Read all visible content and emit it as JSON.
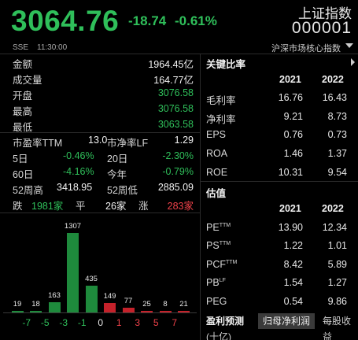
{
  "header": {
    "price": "3064.76",
    "change": "-18.74",
    "change_pct": "-0.61%",
    "index_name": "上证指数",
    "index_code": "000001",
    "exchange": "SSE",
    "time": "11:30:00",
    "subtitle": "沪深市场核心指数"
  },
  "stats": {
    "amount_label": "金额",
    "amount": "1964.45亿",
    "volume_label": "成交量",
    "volume": "164.77亿",
    "open_label": "开盘",
    "open": "3076.58",
    "high_label": "最高",
    "high": "3076.58",
    "low_label": "最低",
    "low": "3063.58",
    "pe_label": "市盈率TTM",
    "pe": "13.0",
    "pb_label": "市净率LF",
    "pb": "1.29",
    "d5_label": "5日",
    "d5": "-0.46%",
    "d20_label": "20日",
    "d20": "-2.30%",
    "d60_label": "60日",
    "d60": "-4.16%",
    "ytd_label": "今年",
    "ytd": "-0.79%",
    "w52h_label": "52周高",
    "w52h": "3418.95",
    "w52l_label": "52周低",
    "w52l": "2885.09",
    "fall_label": "跌",
    "fall": "1981家",
    "flat_label": "平",
    "flat": "26家",
    "rise_label": "涨",
    "rise": "283家"
  },
  "ratios": {
    "title": "关键比率",
    "years": [
      "2021",
      "2022"
    ],
    "rows": [
      {
        "label": "毛利率",
        "v2021": "16.76",
        "v2022": "16.43"
      },
      {
        "label": "净利率",
        "v2021": "9.21",
        "v2022": "8.73"
      },
      {
        "label": "EPS",
        "v2021": "0.76",
        "v2022": "0.73"
      },
      {
        "label": "ROA",
        "v2021": "1.46",
        "v2022": "1.37"
      },
      {
        "label": "ROE",
        "v2021": "10.31",
        "v2022": "9.54"
      }
    ]
  },
  "valuation": {
    "title": "估值",
    "years": [
      "2021",
      "2022"
    ],
    "rows": [
      {
        "label": "PE",
        "sup": "TTM",
        "v2021": "13.90",
        "v2022": "12.34"
      },
      {
        "label": "PS",
        "sup": "TTM",
        "v2021": "1.22",
        "v2022": "1.01"
      },
      {
        "label": "PCF",
        "sup": "TTM",
        "v2021": "8.42",
        "v2022": "5.89"
      },
      {
        "label": "PB",
        "sup": "LF",
        "v2021": "1.54",
        "v2022": "1.27"
      },
      {
        "label": "PEG",
        "sup": "",
        "v2021": "0.54",
        "v2022": "9.86"
      }
    ]
  },
  "tabs": {
    "forecast": "盈利预测",
    "net_profit": "归母净利润",
    "eps": "每股收益",
    "unit": "(十亿)"
  },
  "chart_data": {
    "type": "bar",
    "categories": [
      "-7",
      "-5",
      "-3",
      "-1",
      "0",
      "1",
      "3",
      "5",
      "7"
    ],
    "values": [
      19,
      18,
      163,
      1307,
      435,
      149,
      77,
      25,
      8,
      21
    ],
    "bins": [
      "≤-7",
      "-7~-5",
      "-5~-3",
      "-3~-1",
      "-1~0",
      "0~1",
      "1~3",
      "3~5",
      "5~7",
      "≥7"
    ],
    "colors": [
      "#1e8a3c",
      "#1e8a3c",
      "#1e8a3c",
      "#1e8a3c",
      "#1e8a3c",
      "#c4212a",
      "#c4212a",
      "#c4212a",
      "#c4212a",
      "#c4212a"
    ]
  }
}
